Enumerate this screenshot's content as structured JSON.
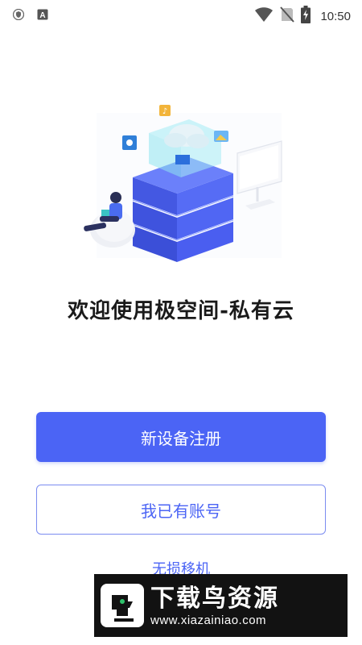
{
  "status_bar": {
    "time": "10:50",
    "left_icons": [
      "shield-icon",
      "a-icon"
    ],
    "right_icons": [
      "wifi-icon",
      "no-sim-icon",
      "battery-charging-icon"
    ]
  },
  "welcome": {
    "title": "欢迎使用极空间-私有云"
  },
  "actions": {
    "register_label": "新设备注册",
    "login_label": "我已有账号",
    "migrate_label": "无损移机"
  },
  "watermark": {
    "title": "下载鸟资源",
    "url": "www.xiazainiao.com"
  },
  "colors": {
    "primary": "#4b64f5",
    "outline": "#7b8cf0",
    "title_text": "#1a1a1a",
    "watermark_bg": "#121212"
  }
}
